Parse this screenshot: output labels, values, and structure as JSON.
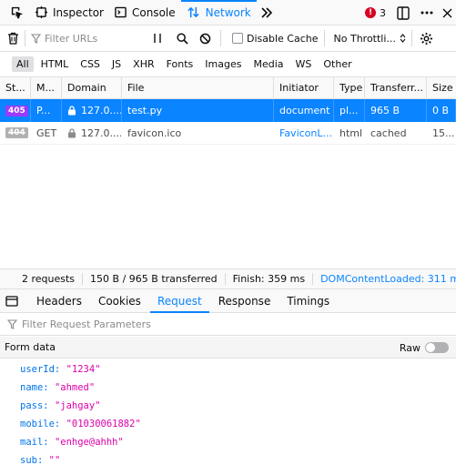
{
  "toolbox": {
    "tabs": [
      {
        "label": "Inspector",
        "icon": "inspector-icon"
      },
      {
        "label": "Console",
        "icon": "console-icon"
      },
      {
        "label": "Network",
        "icon": "network-icon",
        "selected": true
      }
    ],
    "error_count": "3",
    "accent": "#0a84ff"
  },
  "filterbar": {
    "filter_placeholder": "Filter URLs",
    "disable_cache_label": "Disable Cache",
    "throttling_label": "No Throttli..."
  },
  "types": [
    "All",
    "HTML",
    "CSS",
    "JS",
    "XHR",
    "Fonts",
    "Images",
    "Media",
    "WS",
    "Other"
  ],
  "table": {
    "headers": [
      "St...",
      "M...",
      "Domain",
      "File",
      "Initiator",
      "Type",
      "Transferr...",
      "Size"
    ],
    "rows": [
      {
        "status": "405",
        "method": "P...",
        "domain": "127.0....",
        "file": "test.py",
        "initiator": "document",
        "type": "pl...",
        "transferred": "965 B",
        "size": "0 B"
      },
      {
        "status": "404",
        "method": "GET",
        "domain": "127.0....",
        "file": "favicon.ico",
        "initiator": "FaviconL...",
        "type": "html",
        "transferred": "cached",
        "size": "15..."
      }
    ]
  },
  "summary": {
    "requests": "2 requests",
    "transferred": "150 B / 965 B transferred",
    "finish": "Finish: 359 ms",
    "dcl": "DOMContentLoaded: 311 ms"
  },
  "details": {
    "tabs": [
      "Headers",
      "Cookies",
      "Request",
      "Response",
      "Timings"
    ],
    "selected_tab": "Request",
    "filter_placeholder": "Filter Request Parameters",
    "section_title": "Form data",
    "raw_label": "Raw",
    "params": [
      {
        "key": "userId:",
        "value": "\"1234\""
      },
      {
        "key": "name:",
        "value": "\"ahmed\""
      },
      {
        "key": "pass:",
        "value": "\"jahgay\""
      },
      {
        "key": "mobile:",
        "value": "\"01030061882\""
      },
      {
        "key": "mail:",
        "value": "\"enhge@ahhh\""
      },
      {
        "key": "sub:",
        "value": "\"\""
      }
    ]
  }
}
